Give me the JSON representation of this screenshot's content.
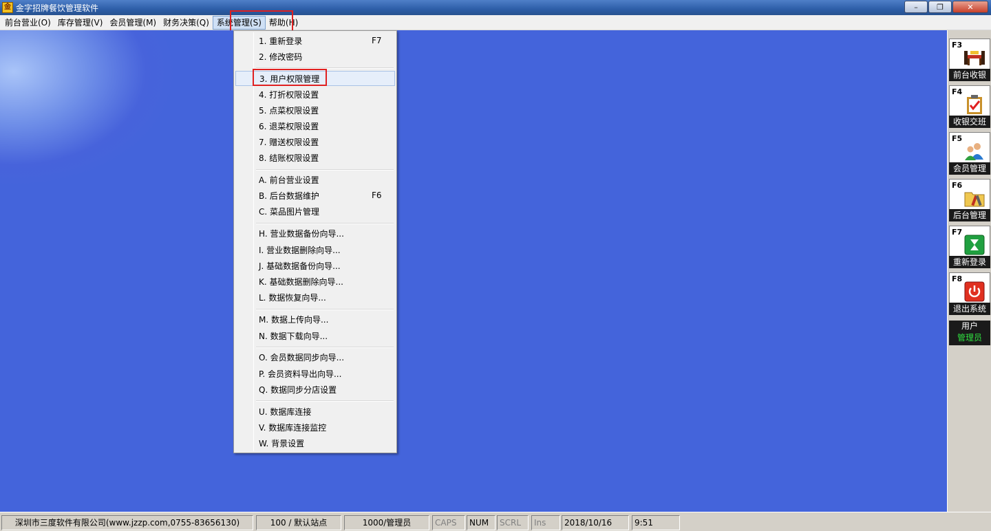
{
  "window": {
    "title": "金字招牌餐饮管理软件",
    "icon": "app-logo-icon",
    "controls": {
      "minimize": "–",
      "maximize": "❐",
      "close": "✕"
    }
  },
  "menubar": {
    "items": [
      {
        "label": "前台营业(O)"
      },
      {
        "label": "库存管理(V)"
      },
      {
        "label": "会员管理(M)"
      },
      {
        "label": "财务决策(Q)"
      },
      {
        "label": "系统管理(S)",
        "active": true
      },
      {
        "label": "帮助(H)"
      }
    ]
  },
  "dropdown": {
    "items": [
      {
        "label": "1. 重新登录",
        "shortcut": "F7"
      },
      {
        "label": "2. 修改密码"
      },
      {
        "label": "3. 用户权限管理",
        "highlighted": true
      },
      {
        "label": "4. 打折权限设置"
      },
      {
        "label": "5. 点菜权限设置"
      },
      {
        "label": "6. 退菜权限设置"
      },
      {
        "label": "7. 赠送权限设置"
      },
      {
        "label": "8. 结账权限设置"
      },
      {
        "label": "A. 前台营业设置"
      },
      {
        "label": "B. 后台数据维护",
        "shortcut": "F6"
      },
      {
        "label": "C. 菜品图片管理"
      },
      {
        "label": "H. 营业数据备份向导..."
      },
      {
        "label": "I. 营业数据删除向导..."
      },
      {
        "label": "J. 基础数据备份向导..."
      },
      {
        "label": "K. 基础数据删除向导..."
      },
      {
        "label": "L. 数据恢复向导..."
      },
      {
        "label": "M. 数据上传向导..."
      },
      {
        "label": "N. 数据下载向导..."
      },
      {
        "label": "O. 会员数据同步向导..."
      },
      {
        "label": "P. 会员资料导出向导..."
      },
      {
        "label": "Q. 数据同步分店设置"
      },
      {
        "label": "U. 数据库连接"
      },
      {
        "label": "V. 数据库连接监控"
      },
      {
        "label": "W. 背景设置"
      }
    ]
  },
  "toolbar": {
    "tools": [
      {
        "key": "F3",
        "label": "前台收银",
        "icon": "cashier-table-icon"
      },
      {
        "key": "F4",
        "label": "收银交班",
        "icon": "clipboard-check-icon"
      },
      {
        "key": "F5",
        "label": "会员管理",
        "icon": "members-icon"
      },
      {
        "key": "F6",
        "label": "后台管理",
        "icon": "folder-tools-icon"
      },
      {
        "key": "F7",
        "label": "重新登录",
        "icon": "hourglass-icon"
      },
      {
        "key": "F8",
        "label": "退出系统",
        "icon": "power-icon"
      }
    ],
    "user_title": "用户",
    "user_name": "管理员"
  },
  "statusbar": {
    "company": "深圳市三度软件有限公司(www.jzzp.com,0755-83656130)",
    "station": "100 / 默认站点",
    "operator": "1000/管理员",
    "caps": "CAPS",
    "num": "NUM",
    "scrl": "SCRL",
    "ins": "Ins",
    "date": "2018/10/16",
    "time": "9:51"
  },
  "colors": {
    "desktop": "#4464db",
    "highlight_box": "#e02020",
    "user_name": "#30e040"
  }
}
